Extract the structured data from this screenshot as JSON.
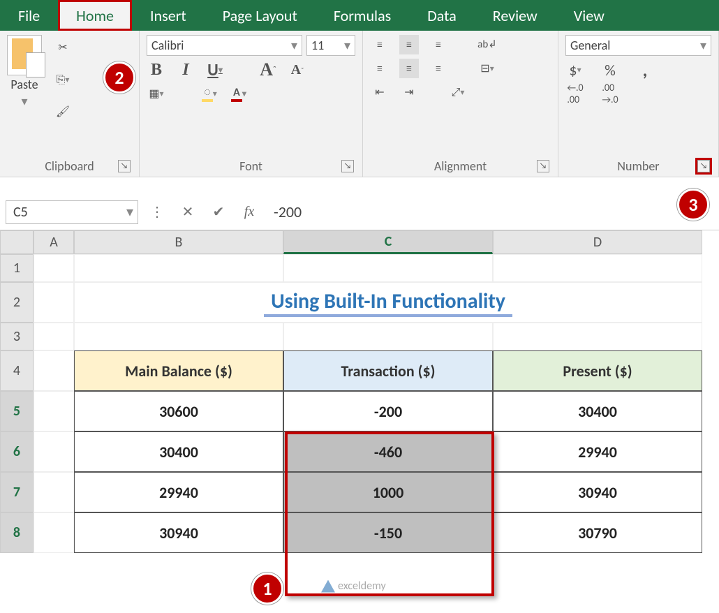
{
  "tabs": [
    "File",
    "Home",
    "Insert",
    "Page Layout",
    "Formulas",
    "Data",
    "Review",
    "View"
  ],
  "active_tab": "Home",
  "ribbon": {
    "clipboard": {
      "paste": "Paste",
      "label": "Clipboard"
    },
    "font": {
      "name": "Calibri",
      "size": "11",
      "label": "Font",
      "bold": "B",
      "italic": "I",
      "underline": "U",
      "growA": "A",
      "shrinkA": "A",
      "fontcolor": "A",
      "fill": "🪣"
    },
    "alignment": {
      "label": "Alignment",
      "wrap": "ab"
    },
    "number": {
      "label": "Number",
      "format": "General",
      "currency": "$",
      "percent": "%",
      "comma": ",",
      "incdec": "←.0",
      "decdec": ".00→"
    }
  },
  "callouts": {
    "c1": "1",
    "c2": "2",
    "c3": "3"
  },
  "namebox": "C5",
  "formula": "-200",
  "columns": [
    "A",
    "B",
    "C",
    "D"
  ],
  "rows": [
    "1",
    "2",
    "3",
    "4",
    "5",
    "6",
    "7",
    "8"
  ],
  "sheet_title": "Using Built-In Functionality",
  "table": {
    "headers": [
      "Main Balance ($)",
      "Transaction ($)",
      "Present ($)"
    ],
    "rows": [
      {
        "b": "30600",
        "c": "-200",
        "d": "30400"
      },
      {
        "b": "30400",
        "c": "-460",
        "d": "29940"
      },
      {
        "b": "29940",
        "c": "1000",
        "d": "30940"
      },
      {
        "b": "30940",
        "c": "-150",
        "d": "30790"
      }
    ]
  },
  "watermark": "exceldemy"
}
